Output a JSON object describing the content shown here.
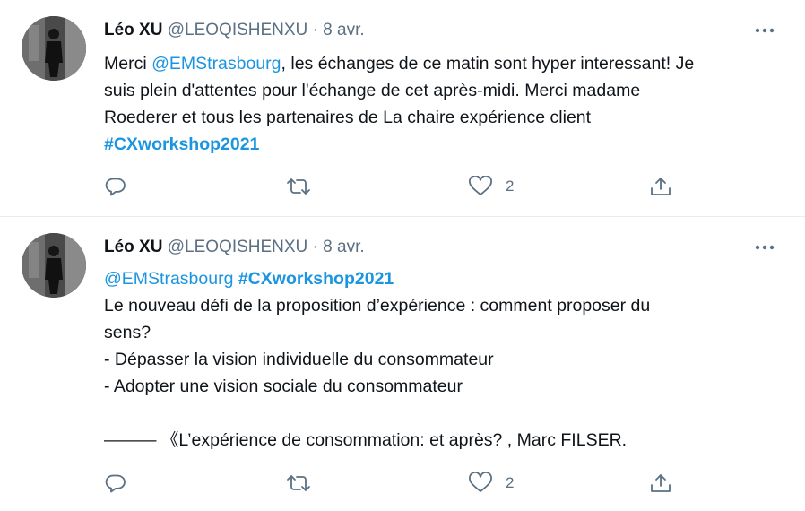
{
  "tweets": [
    {
      "author": {
        "name": "Léo XU",
        "handle": "@LEOQISHENXU"
      },
      "separator": "·",
      "date": "8 avr.",
      "lines": [
        [
          {
            "kind": "text",
            "text": "Merci "
          },
          {
            "kind": "mention",
            "text": "@EMStrasbourg"
          },
          {
            "kind": "text",
            "text": ", les échanges de ce matin sont hyper interessant! Je"
          }
        ],
        [
          {
            "kind": "text",
            "text": "suis plein d'attentes pour l'échange de cet après-midi. Merci madame"
          }
        ],
        [
          {
            "kind": "text",
            "text": "Roederer et tous les partenaires de La chaire expérience client"
          }
        ],
        [
          {
            "kind": "hashtag",
            "text": "#CXworkshop2021"
          }
        ]
      ],
      "actions": {
        "reply": {
          "icon": "reply-icon"
        },
        "retweet": {
          "icon": "retweet-icon"
        },
        "like": {
          "icon": "heart-icon",
          "count": "2"
        },
        "share": {
          "icon": "share-icon"
        }
      }
    },
    {
      "author": {
        "name": "Léo XU",
        "handle": "@LEOQISHENXU"
      },
      "separator": "·",
      "date": "8 avr.",
      "lines": [
        [
          {
            "kind": "mention",
            "text": "@EMStrasbourg"
          },
          {
            "kind": "text",
            "text": " "
          },
          {
            "kind": "hashtag",
            "text": "#CXworkshop2021"
          }
        ],
        [
          {
            "kind": "text",
            "text": "Le nouveau défi de la proposition d’expérience : comment proposer du"
          }
        ],
        [
          {
            "kind": "text",
            "text": "sens?"
          }
        ],
        [
          {
            "kind": "text",
            "text": "- Dépasser la vision individuelle du consommateur"
          }
        ],
        [
          {
            "kind": "text",
            "text": "- Adopter une vision sociale du consommateur"
          }
        ],
        [
          {
            "kind": "text",
            "text": ""
          }
        ],
        [
          {
            "kind": "text",
            "text": "——— 《L’expérience de consommation: et après? , Marc FILSER."
          }
        ]
      ],
      "actions": {
        "reply": {
          "icon": "reply-icon"
        },
        "retweet": {
          "icon": "retweet-icon"
        },
        "like": {
          "icon": "heart-icon",
          "count": "2"
        },
        "share": {
          "icon": "share-icon"
        }
      }
    }
  ],
  "colors": {
    "link": "#1b95e0",
    "text": "#0f1419",
    "muted": "#5b7083",
    "divider": "#e6ecf0"
  }
}
